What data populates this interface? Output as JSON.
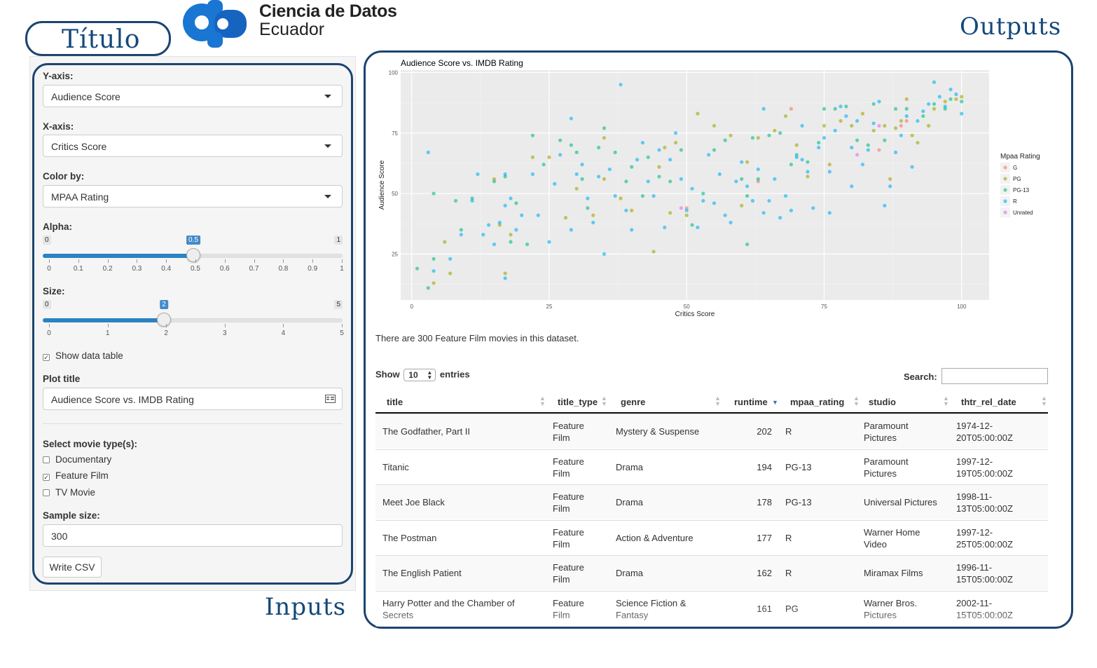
{
  "annotations": {
    "titulo": "Título",
    "outputs": "Outputs",
    "inputs": "Inputs"
  },
  "logo": {
    "line1": "Ciencia de Datos",
    "line2": "Ecuador",
    "color": "#1976d2"
  },
  "sidebar": {
    "y_axis": {
      "label": "Y-axis:",
      "value": "Audience Score"
    },
    "x_axis": {
      "label": "X-axis:",
      "value": "Critics Score"
    },
    "color_by": {
      "label": "Color by:",
      "value": "MPAA Rating"
    },
    "alpha": {
      "label": "Alpha:",
      "min": "0",
      "max": "1",
      "value": "0.5",
      "ticks": [
        "0",
        "0.1",
        "0.2",
        "0.3",
        "0.4",
        "0.5",
        "0.6",
        "0.7",
        "0.8",
        "0.9",
        "1"
      ]
    },
    "size": {
      "label": "Size:",
      "min": "0",
      "max": "5",
      "value": "2",
      "ticks": [
        "0",
        "1",
        "2",
        "3",
        "4",
        "5"
      ]
    },
    "show_table": {
      "label": "Show data table",
      "checked": true
    },
    "plot_title": {
      "label": "Plot title",
      "value": "Audience Score vs. IMDB Rating"
    },
    "movie_types": {
      "label": "Select movie type(s):",
      "options": [
        {
          "label": "Documentary",
          "checked": false
        },
        {
          "label": "Feature Film",
          "checked": true
        },
        {
          "label": "TV Movie",
          "checked": false
        }
      ]
    },
    "sample_size": {
      "label": "Sample size:",
      "value": "300"
    },
    "write_csv": "Write CSV"
  },
  "chart_data": {
    "type": "scatter",
    "title": "Audience Score vs. IMDB Rating",
    "xlabel": "Critics Score",
    "ylabel": "Audience Score",
    "xlim": [
      -2,
      105
    ],
    "ylim": [
      6,
      101
    ],
    "xticks": [
      "0",
      "25",
      "50",
      "75",
      "100"
    ],
    "yticks": [
      "25",
      "50",
      "75",
      "100"
    ],
    "grid": true,
    "legend_title": "Mpaa Rating",
    "legend_position": "right",
    "series": [
      {
        "name": "G",
        "color": "#f8766d",
        "points": [
          [
            50,
            44
          ],
          [
            63,
            55
          ],
          [
            69,
            85
          ],
          [
            85,
            68
          ],
          [
            89,
            78
          ],
          [
            90,
            80
          ]
        ]
      },
      {
        "name": "PG",
        "color": "#a3a500",
        "points": [
          [
            4,
            13
          ],
          [
            6,
            30
          ],
          [
            7,
            17
          ],
          [
            15,
            56
          ],
          [
            16,
            37
          ],
          [
            17,
            17
          ],
          [
            18,
            33
          ],
          [
            22,
            65
          ],
          [
            25,
            65
          ],
          [
            28,
            40
          ],
          [
            30,
            52
          ],
          [
            33,
            41
          ],
          [
            35,
            56
          ],
          [
            35,
            73
          ],
          [
            38,
            48
          ],
          [
            40,
            43
          ],
          [
            45,
            61
          ],
          [
            46,
            69
          ],
          [
            47,
            42
          ],
          [
            48,
            71
          ],
          [
            50,
            41
          ],
          [
            52,
            83
          ],
          [
            55,
            78
          ],
          [
            58,
            74
          ],
          [
            61,
            63
          ],
          [
            63,
            73
          ],
          [
            66,
            76
          ],
          [
            68,
            82
          ],
          [
            70,
            70
          ],
          [
            75,
            78
          ],
          [
            78,
            80
          ],
          [
            80,
            78
          ],
          [
            82,
            83
          ],
          [
            84,
            76
          ],
          [
            86,
            78
          ],
          [
            88,
            77
          ],
          [
            89,
            80
          ],
          [
            90,
            89
          ],
          [
            91,
            74
          ],
          [
            92,
            71
          ],
          [
            94,
            78
          ],
          [
            95,
            85
          ],
          [
            97,
            88
          ],
          [
            99,
            89
          ],
          [
            100,
            90
          ],
          [
            87,
            56
          ],
          [
            60,
            45
          ],
          [
            72,
            57
          ],
          [
            76,
            62
          ],
          [
            44,
            26
          ]
        ]
      },
      {
        "name": "PG-13",
        "color": "#00bf7d",
        "points": [
          [
            1,
            19
          ],
          [
            3,
            11
          ],
          [
            4,
            23
          ],
          [
            4,
            50
          ],
          [
            8,
            47
          ],
          [
            9,
            35
          ],
          [
            11,
            48
          ],
          [
            15,
            55
          ],
          [
            17,
            57
          ],
          [
            18,
            30
          ],
          [
            19,
            46
          ],
          [
            21,
            29
          ],
          [
            22,
            74
          ],
          [
            24,
            62
          ],
          [
            27,
            72
          ],
          [
            29,
            70
          ],
          [
            30,
            67
          ],
          [
            31,
            56
          ],
          [
            32,
            44
          ],
          [
            34,
            69
          ],
          [
            35,
            77
          ],
          [
            37,
            67
          ],
          [
            39,
            55
          ],
          [
            40,
            61
          ],
          [
            42,
            49
          ],
          [
            43,
            65
          ],
          [
            45,
            57
          ],
          [
            47,
            55
          ],
          [
            49,
            68
          ],
          [
            51,
            37
          ],
          [
            53,
            50
          ],
          [
            55,
            68
          ],
          [
            57,
            72
          ],
          [
            60,
            56
          ],
          [
            61,
            49
          ],
          [
            61,
            29
          ],
          [
            62,
            73
          ],
          [
            63,
            56
          ],
          [
            65,
            74
          ],
          [
            67,
            75
          ],
          [
            69,
            62
          ],
          [
            70,
            66
          ],
          [
            72,
            63
          ],
          [
            74,
            71
          ],
          [
            75,
            85
          ],
          [
            77,
            85
          ],
          [
            79,
            86
          ],
          [
            81,
            72
          ],
          [
            83,
            70
          ],
          [
            84,
            87
          ],
          [
            86,
            72
          ],
          [
            88,
            85
          ],
          [
            90,
            85
          ],
          [
            93,
            82
          ],
          [
            95,
            87
          ],
          [
            97,
            85
          ],
          [
            98,
            89
          ],
          [
            100,
            88
          ]
        ]
      },
      {
        "name": "R",
        "color": "#00b0f6",
        "points": [
          [
            3,
            67
          ],
          [
            4,
            18
          ],
          [
            7,
            23
          ],
          [
            9,
            33
          ],
          [
            11,
            47
          ],
          [
            12,
            58
          ],
          [
            13,
            33
          ],
          [
            14,
            37
          ],
          [
            15,
            29
          ],
          [
            16,
            38
          ],
          [
            17,
            15
          ],
          [
            17,
            45
          ],
          [
            17,
            58
          ],
          [
            18,
            48
          ],
          [
            19,
            35
          ],
          [
            20,
            41
          ],
          [
            22,
            58
          ],
          [
            23,
            41
          ],
          [
            25,
            30
          ],
          [
            26,
            54
          ],
          [
            27,
            66
          ],
          [
            29,
            35
          ],
          [
            29,
            81
          ],
          [
            30,
            58
          ],
          [
            31,
            62
          ],
          [
            32,
            48
          ],
          [
            33,
            38
          ],
          [
            34,
            57
          ],
          [
            35,
            25
          ],
          [
            36,
            60
          ],
          [
            37,
            49
          ],
          [
            38,
            95
          ],
          [
            39,
            43
          ],
          [
            40,
            35
          ],
          [
            41,
            64
          ],
          [
            42,
            71
          ],
          [
            43,
            55
          ],
          [
            44,
            49
          ],
          [
            45,
            68
          ],
          [
            46,
            36
          ],
          [
            47,
            64
          ],
          [
            48,
            75
          ],
          [
            49,
            56
          ],
          [
            50,
            43
          ],
          [
            51,
            52
          ],
          [
            52,
            36
          ],
          [
            53,
            47
          ],
          [
            54,
            66
          ],
          [
            55,
            46
          ],
          [
            56,
            58
          ],
          [
            57,
            41
          ],
          [
            58,
            38
          ],
          [
            59,
            55
          ],
          [
            60,
            63
          ],
          [
            61,
            53
          ],
          [
            62,
            47
          ],
          [
            63,
            60
          ],
          [
            64,
            42
          ],
          [
            65,
            47
          ],
          [
            66,
            56
          ],
          [
            67,
            40
          ],
          [
            68,
            49
          ],
          [
            69,
            43
          ],
          [
            70,
            65
          ],
          [
            71,
            78
          ],
          [
            72,
            59
          ],
          [
            73,
            44
          ],
          [
            74,
            69
          ],
          [
            75,
            73
          ],
          [
            76,
            42
          ],
          [
            77,
            76
          ],
          [
            78,
            86
          ],
          [
            79,
            82
          ],
          [
            80,
            69
          ],
          [
            81,
            80
          ],
          [
            82,
            62
          ],
          [
            83,
            68
          ],
          [
            84,
            79
          ],
          [
            85,
            88
          ],
          [
            86,
            45
          ],
          [
            87,
            53
          ],
          [
            88,
            67
          ],
          [
            89,
            74
          ],
          [
            90,
            82
          ],
          [
            91,
            61
          ],
          [
            92,
            80
          ],
          [
            93,
            84
          ],
          [
            94,
            87
          ],
          [
            95,
            96
          ],
          [
            96,
            90
          ],
          [
            97,
            86
          ],
          [
            99,
            91
          ],
          [
            100,
            83
          ],
          [
            98,
            93
          ],
          [
            71,
            64
          ],
          [
            76,
            59
          ],
          [
            80,
            53
          ],
          [
            64,
            85
          ]
        ]
      },
      {
        "name": "Unrated",
        "color": "#e76bf3",
        "points": [
          [
            49,
            44
          ],
          [
            81,
            66
          ],
          [
            85,
            78
          ]
        ]
      }
    ]
  },
  "summary": "There are 300 Feature Film movies in this dataset.",
  "table": {
    "show_label": "Show",
    "entries_label": "entries",
    "page_length": "10",
    "search_label": "Search:",
    "columns": [
      "title",
      "title_type",
      "genre",
      "runtime",
      "mpaa_rating",
      "studio",
      "thtr_rel_date"
    ],
    "rows": [
      [
        "The Godfather, Part II",
        "Feature\nFilm",
        "Mystery & Suspense",
        "202",
        "R",
        "Paramount\nPictures",
        "1974-12-\n20T05:00:00Z"
      ],
      [
        "Titanic",
        "Feature\nFilm",
        "Drama",
        "194",
        "PG-13",
        "Paramount\nPictures",
        "1997-12-\n19T05:00:00Z"
      ],
      [
        "Meet Joe Black",
        "Feature\nFilm",
        "Drama",
        "178",
        "PG-13",
        "Universal Pictures",
        "1998-11-\n13T05:00:00Z"
      ],
      [
        "The Postman",
        "Feature\nFilm",
        "Action & Adventure",
        "177",
        "R",
        "Warner Home\nVideo",
        "1997-12-\n25T05:00:00Z"
      ],
      [
        "The English Patient",
        "Feature\nFilm",
        "Drama",
        "162",
        "R",
        "Miramax Films",
        "1996-11-\n15T05:00:00Z"
      ],
      [
        "Harry Potter and the Chamber of\nSecrets",
        "Feature\nFilm",
        "Science Fiction &\nFantasy",
        "161",
        "PG",
        "Warner Bros.\nPictures",
        "2002-11-\n15T05:00:00Z"
      ]
    ]
  }
}
